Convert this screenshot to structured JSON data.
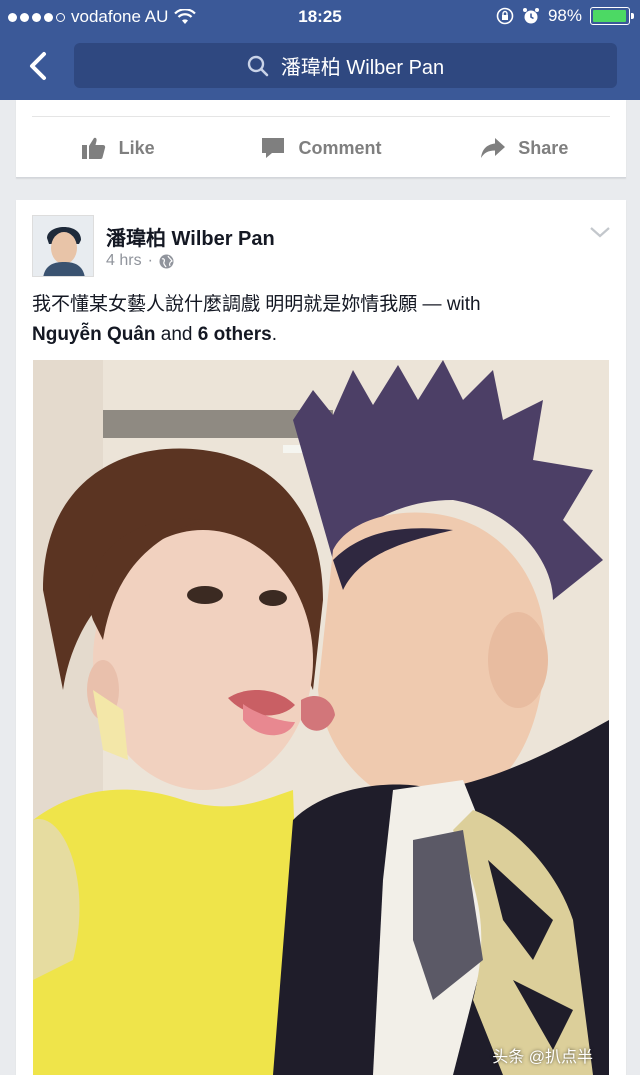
{
  "status_bar": {
    "carrier": "vodafone AU",
    "time": "18:25",
    "battery_percent": "98%",
    "battery_level": 0.98,
    "colors": {
      "battery_fill": "#4cd964"
    }
  },
  "nav": {
    "search_text": "潘瑋柏 Wilber Pan",
    "icons": {
      "back": "chevron-left-icon",
      "search": "search-icon"
    },
    "colors": {
      "bar": "#3b5998",
      "search_bg": "#2f4880"
    }
  },
  "previous_post": {
    "actions": {
      "like": "Like",
      "comment": "Comment",
      "share": "Share"
    }
  },
  "post": {
    "author": "潘瑋柏 Wilber Pan",
    "time": "4 hrs",
    "privacy_icon": "globe-icon",
    "text_prefix": "我不懂某女藝人說什麼調戲 明明就是妳情我願 — with ",
    "tag_person": "Nguyễn Quân",
    "tag_and": " and ",
    "tag_others": "6 others",
    "tag_end": ".",
    "photo_watermark": "头条 @扒点半"
  }
}
